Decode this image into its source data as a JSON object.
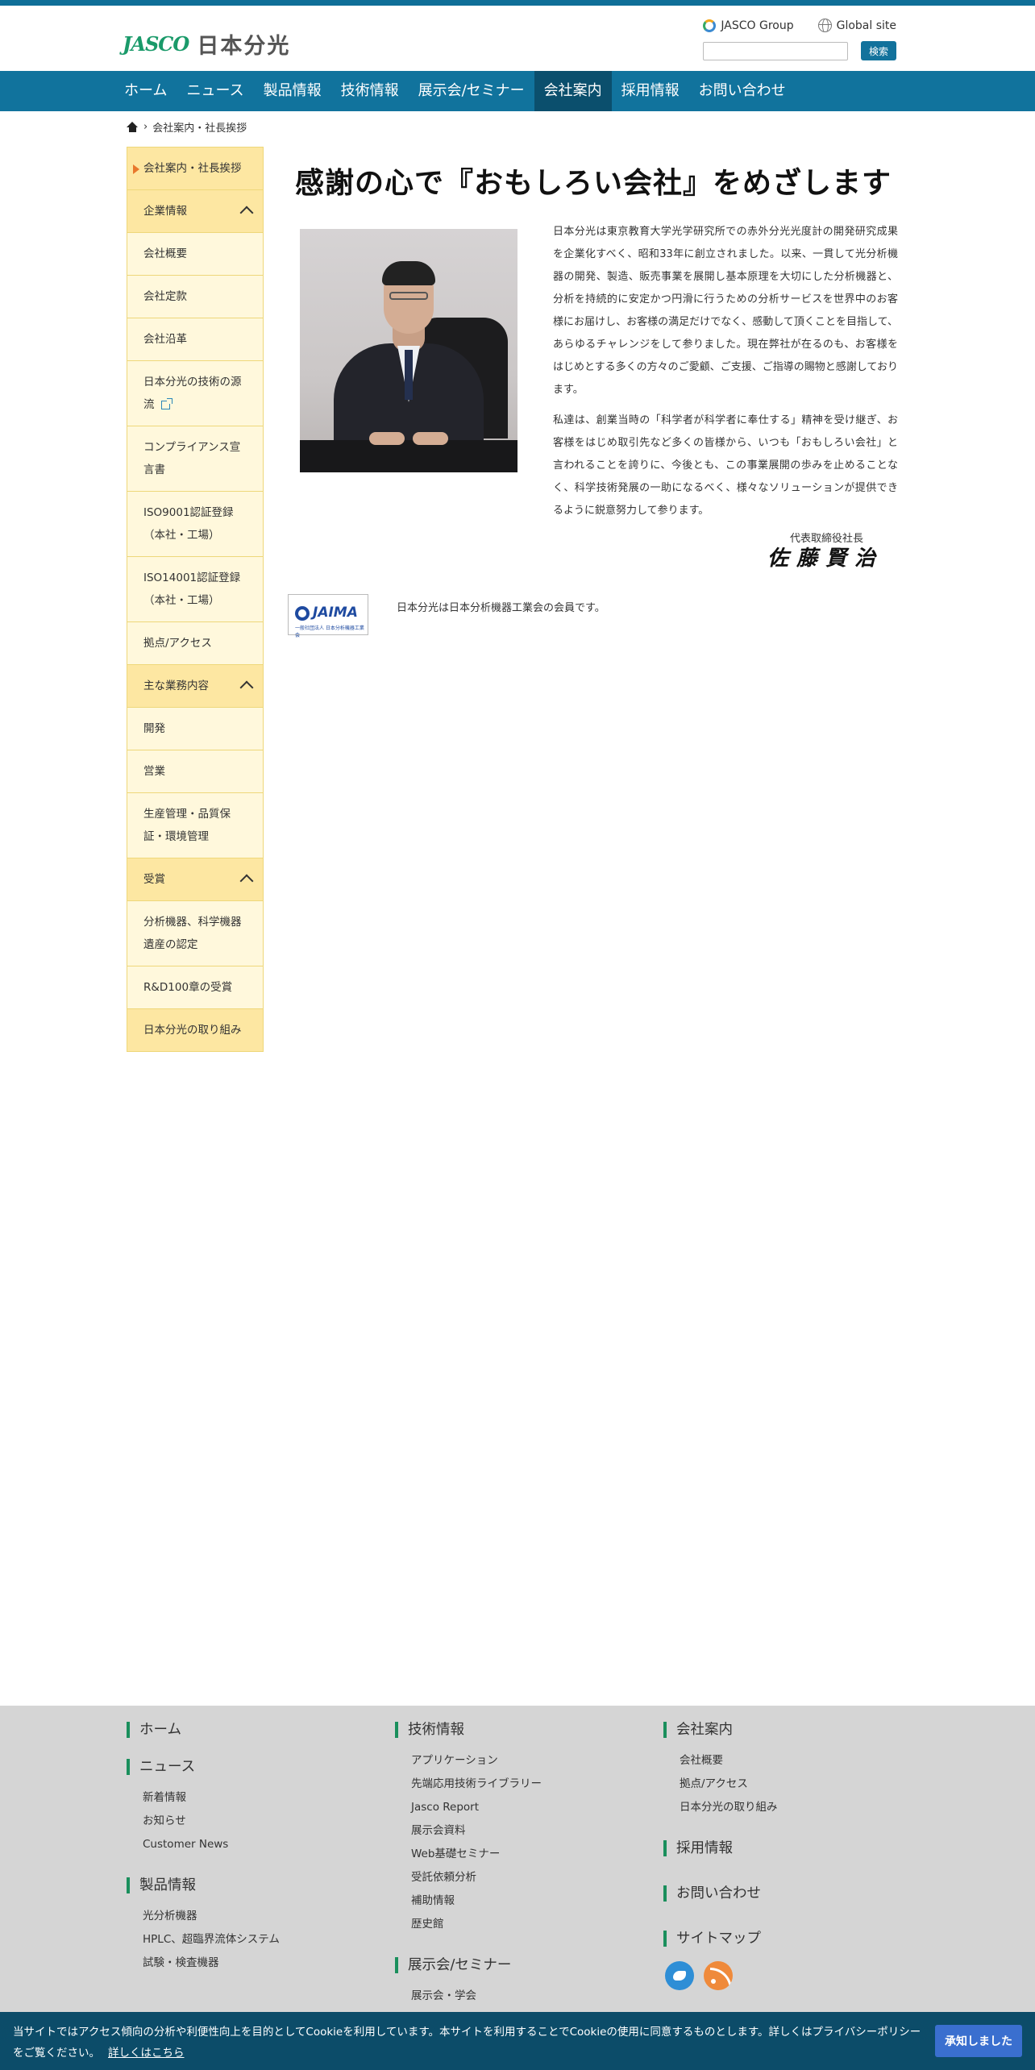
{
  "header": {
    "logo_en": "JASCO",
    "logo_jp": "日本分光",
    "links": [
      "JASCO Group",
      "Global site"
    ],
    "search_value": "",
    "search_button": "検索"
  },
  "nav": {
    "items": [
      "ホーム",
      "ニュース",
      "製品情報",
      "技術情報",
      "展示会/セミナー",
      "会社案内",
      "採用情報",
      "お問い合わせ"
    ],
    "active": "会社案内"
  },
  "breadcrumb": {
    "current": "会社案内・社長挨拶"
  },
  "sidebar": {
    "items": [
      "会社案内・社長挨拶",
      "企業情報",
      "会社概要",
      "会社定款",
      "会社沿革",
      "日本分光の技術の源流",
      "コンプライアンス宣言書",
      "ISO9001認証登録（本社・工場）",
      "ISO14001認証登録（本社・工場）",
      "拠点/アクセス",
      "主な業務内容",
      "開発",
      "営業",
      "生産管理・品質保証・環境管理",
      "受賞",
      "分析機器、科学機器遺産の認定",
      "R&D100章の受賞",
      "日本分光の取り組み"
    ]
  },
  "main": {
    "headline": "感謝の心で『おもしろい会社』をめざします",
    "paragraphs": [
      "日本分光は東京教育大学光学研究所での赤外分光光度計の開発研究成果を企業化すべく、昭和33年に創立されました。以来、一貫して光分析機器の開発、製造、販売事業を展開し基本原理を大切にした分析機器と、分析を持続的に安定かつ円滑に行うための分析サービスを世界中のお客様にお届けし、お客様の満足だけでなく、感動して頂くことを目指して、あらゆるチャレンジをして参りました。現在弊社が在るのも、お客様をはじめとする多くの方々のご愛顧、ご支援、ご指導の賜物と感謝しております。",
      "私達は、創業当時の「科学者が科学者に奉仕する」精神を受け継ぎ、お客様をはじめ取引先など多くの皆様から、いつも「おもしろい会社」と言われることを誇りに、今後とも、この事業展開の歩みを止めることなく、科学技術発展の一助になるべく、様々なソリューションが提供できるように鋭意努力して参ります。"
    ],
    "sign_title": "代表取締役社長",
    "sign_name": "佐藤賢治",
    "jaima_logo": "JAIMA",
    "jaima_sub": "一般社団法人 日本分析機器工業会",
    "member_text": "日本分光は日本分析機器工業会の会員です。"
  },
  "footer": {
    "col1": [
      {
        "head": "ホーム",
        "items": []
      },
      {
        "head": "ニュース",
        "items": [
          "新着情報",
          "お知らせ",
          "Customer News"
        ]
      },
      {
        "head": "製品情報",
        "items": [
          "光分析機器",
          "HPLC、超臨界流体システム",
          "試験・検査機器"
        ]
      }
    ],
    "col2": [
      {
        "head": "技術情報",
        "items": [
          "アプリケーション",
          "先端応用技術ライブラリー",
          "Jasco Report",
          "展示会資料",
          "Web基礎セミナー",
          "受託依頼分析",
          "補助情報",
          "歴史館"
        ]
      },
      {
        "head": "展示会/セミナー",
        "items": [
          "展示会・学会"
        ]
      }
    ],
    "col3": [
      {
        "head": "会社案内",
        "items": [
          "会社概要",
          "拠点/アクセス",
          "日本分光の取り組み"
        ]
      },
      {
        "head": "採用情報",
        "items": []
      },
      {
        "head": "お問い合わせ",
        "items": []
      },
      {
        "head": "サイトマップ",
        "items": []
      }
    ]
  },
  "cookie": {
    "text": "当サイトではアクセス傾向の分析や利便性向上を目的としてCookieを利用しています。本サイトを利用することでCookieの使用に同意するものとします。詳しくはプライバシーポリシーをご覧ください。",
    "link": "詳しくはこちら",
    "button": "承知しました"
  },
  "colors": {
    "brand_blue": "#11739d",
    "nav_active": "#0b4f6d",
    "sidebar_bg": "#fff6d3",
    "footer_bg": "#d5d5d5",
    "cookie_bg": "#0c4c69",
    "accent_green": "#1a8f5c"
  }
}
